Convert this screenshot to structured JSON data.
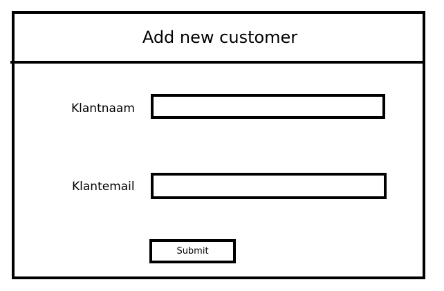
{
  "page": {
    "title": "Add new customer"
  },
  "form": {
    "name_label": "Klantnaam",
    "name_value": "",
    "email_label": "Klantemail",
    "email_value": "",
    "submit_label": "Submit"
  }
}
